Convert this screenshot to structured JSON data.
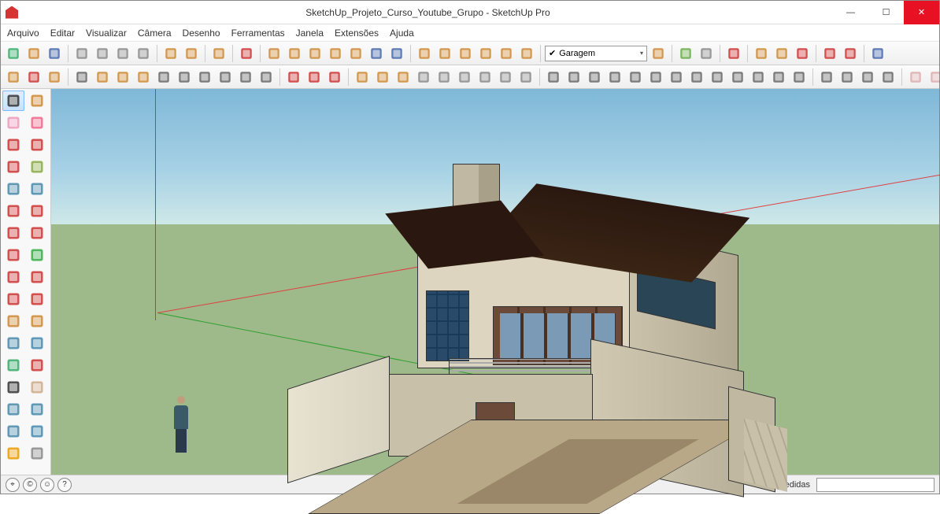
{
  "window": {
    "title": "SketchUp_Projeto_Curso_Youtube_Grupo - SketchUp Pro",
    "minimize": "—",
    "maximize": "☐",
    "close": "✕"
  },
  "menu": [
    "Arquivo",
    "Editar",
    "Visualizar",
    "Câmera",
    "Desenho",
    "Ferramentas",
    "Janela",
    "Extensões",
    "Ajuda"
  ],
  "layer": {
    "selected": "Garagem"
  },
  "status": {
    "geo": "⌖",
    "credits": "©",
    "user": "☺",
    "help": "?",
    "measure_label": "Medidas"
  },
  "palette": [
    "select",
    "lasso",
    "eraser-soft",
    "eraser-hard",
    "line",
    "freehand",
    "rect",
    "rect-rot",
    "circle",
    "poly",
    "arc",
    "arc2",
    "pie",
    "curve",
    "move",
    "rotate",
    "scale",
    "offset",
    "pushpull",
    "followme",
    "tape",
    "protractor",
    "dim",
    "text",
    "axes",
    "section",
    "grip",
    "paint",
    "zoom",
    "zoom-ext",
    "iso",
    "look",
    "sun",
    "xray"
  ],
  "toolbar1": [
    {
      "n": "new",
      "c": "#3a6"
    },
    {
      "n": "open",
      "c": "#c83"
    },
    {
      "n": "save",
      "c": "#46a"
    },
    {
      "s": 1
    },
    {
      "n": "cut",
      "c": "#888"
    },
    {
      "n": "copy",
      "c": "#888"
    },
    {
      "n": "paste",
      "c": "#888"
    },
    {
      "n": "cancel",
      "c": "#888"
    },
    {
      "s": 1
    },
    {
      "n": "undo",
      "c": "#c83"
    },
    {
      "n": "redo",
      "c": "#c83"
    },
    {
      "s": 1
    },
    {
      "n": "print",
      "c": "#c83"
    },
    {
      "s": 1
    },
    {
      "n": "model-a",
      "c": "#c33"
    },
    {
      "s": 1
    },
    {
      "n": "iso",
      "c": "#c83"
    },
    {
      "n": "top",
      "c": "#c83"
    },
    {
      "n": "front",
      "c": "#c83"
    },
    {
      "n": "right",
      "c": "#c83"
    },
    {
      "n": "back",
      "c": "#c83"
    },
    {
      "n": "left",
      "c": "#46a"
    },
    {
      "n": "persp",
      "c": "#46a"
    },
    {
      "s": 1
    },
    {
      "n": "comp1",
      "c": "#c83"
    },
    {
      "n": "comp2",
      "c": "#c83"
    },
    {
      "n": "house1",
      "c": "#c83"
    },
    {
      "n": "house2",
      "c": "#c83"
    },
    {
      "n": "house3",
      "c": "#c83"
    },
    {
      "n": "house4",
      "c": "#c83"
    },
    {
      "s": 1
    },
    {
      "layer": 1
    },
    {
      "n": "layer-ico",
      "c": "#c83"
    },
    {
      "s": 1
    },
    {
      "n": "map",
      "c": "#6a4"
    },
    {
      "n": "place",
      "c": "#888"
    },
    {
      "s": 1
    },
    {
      "n": "pin",
      "c": "#c33"
    },
    {
      "s": 1
    },
    {
      "n": "warehouse",
      "c": "#c83"
    },
    {
      "n": "share",
      "c": "#c83"
    },
    {
      "n": "upload",
      "c": "#c33"
    },
    {
      "s": 1
    },
    {
      "n": "ext1",
      "c": "#c33"
    },
    {
      "n": "ext2",
      "c": "#c33"
    },
    {
      "s": 1
    },
    {
      "n": "ext3",
      "c": "#46a"
    }
  ],
  "toolbar2": [
    {
      "n": "t1",
      "c": "#c83"
    },
    {
      "n": "t2",
      "c": "#c33"
    },
    {
      "n": "t3",
      "c": "#c83"
    },
    {
      "s": 1
    },
    {
      "n": "xa",
      "c": "#666"
    },
    {
      "n": "xb",
      "c": "#c83"
    },
    {
      "n": "xc",
      "c": "#c83"
    },
    {
      "n": "xd",
      "c": "#c83"
    },
    {
      "n": "xe",
      "c": "#666"
    },
    {
      "n": "xf",
      "c": "#666"
    },
    {
      "n": "xg",
      "c": "#666"
    },
    {
      "n": "xh",
      "c": "#666"
    },
    {
      "n": "xi",
      "c": "#666"
    },
    {
      "n": "xj",
      "c": "#666"
    },
    {
      "s": 1
    },
    {
      "n": "m1",
      "c": "#c33"
    },
    {
      "n": "m2",
      "c": "#c33"
    },
    {
      "n": "m3",
      "c": "#c33"
    },
    {
      "s": 1
    },
    {
      "n": "c1",
      "c": "#c83"
    },
    {
      "n": "c2",
      "c": "#c83"
    },
    {
      "n": "c3",
      "c": "#c83"
    },
    {
      "n": "c4",
      "c": "#888"
    },
    {
      "n": "c5",
      "c": "#888"
    },
    {
      "n": "c6",
      "c": "#888"
    },
    {
      "n": "c7",
      "c": "#888"
    },
    {
      "n": "c8",
      "c": "#888"
    },
    {
      "n": "c9",
      "c": "#888"
    },
    {
      "s": 1
    },
    {
      "n": "l1",
      "c": "#666"
    },
    {
      "n": "l2",
      "c": "#666"
    },
    {
      "n": "l3",
      "c": "#666"
    },
    {
      "n": "l4",
      "c": "#666"
    },
    {
      "n": "l5",
      "c": "#666"
    },
    {
      "n": "l6",
      "c": "#666"
    },
    {
      "n": "l7",
      "c": "#666"
    },
    {
      "n": "l8",
      "c": "#666"
    },
    {
      "n": "l9",
      "c": "#666"
    },
    {
      "n": "l10",
      "c": "#666"
    },
    {
      "n": "l11",
      "c": "#666"
    },
    {
      "n": "l12",
      "c": "#666"
    },
    {
      "n": "l13",
      "c": "#666"
    },
    {
      "s": 1
    },
    {
      "n": "s1",
      "c": "#666"
    },
    {
      "n": "s2",
      "c": "#666"
    },
    {
      "n": "s3",
      "c": "#666"
    },
    {
      "n": "s4",
      "c": "#666"
    },
    {
      "s": 1
    },
    {
      "n": "p1",
      "c": "#daa"
    },
    {
      "n": "p2",
      "c": "#daa"
    },
    {
      "n": "p3",
      "c": "#8a6"
    },
    {
      "n": "p4",
      "c": "#a86"
    },
    {
      "n": "p5",
      "c": "#ca6"
    }
  ]
}
